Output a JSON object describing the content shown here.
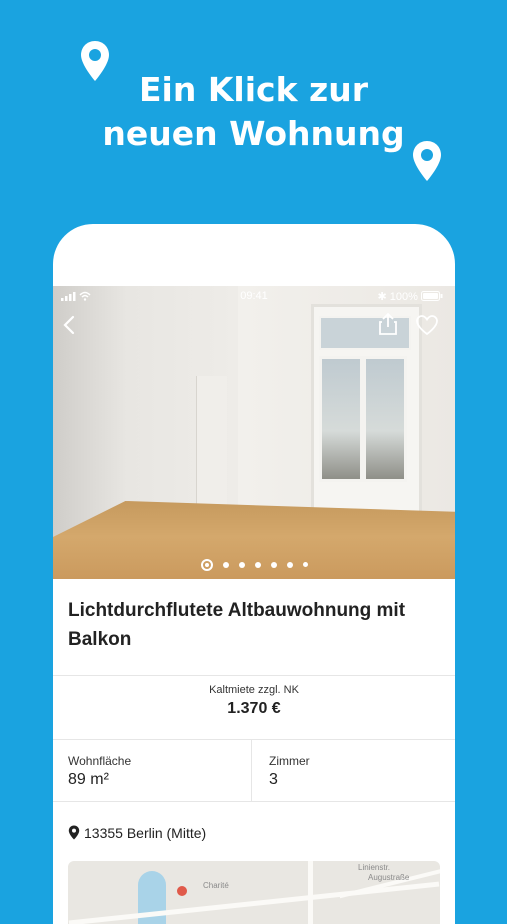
{
  "headline": {
    "line1": "Ein Klick zur",
    "line2": "neuen Wohnung"
  },
  "status": {
    "time": "09:41",
    "battery": "100%"
  },
  "gallery": {
    "dot_count": 7,
    "active_index": 0
  },
  "listing": {
    "title": "Lichtdurchflutete Altbauwohnung mit Balkon",
    "price_label": "Kaltmiete zzgl. NK",
    "price_value": "1.370 €",
    "area_label": "Wohnfläche",
    "area_value": "89 m²",
    "rooms_label": "Zimmer",
    "rooms_value": "3",
    "location": "13355 Berlin (Mitte)"
  },
  "map": {
    "labels": [
      "Charité",
      "Augustraße",
      "Linienstr."
    ]
  },
  "colors": {
    "background": "#1aa3e0",
    "text": "#222222",
    "floor": "#c69a5e"
  },
  "icons": [
    "location-pin-icon",
    "back-icon",
    "share-icon",
    "heart-icon",
    "signal-icon",
    "wifi-icon",
    "bluetooth-icon"
  ]
}
